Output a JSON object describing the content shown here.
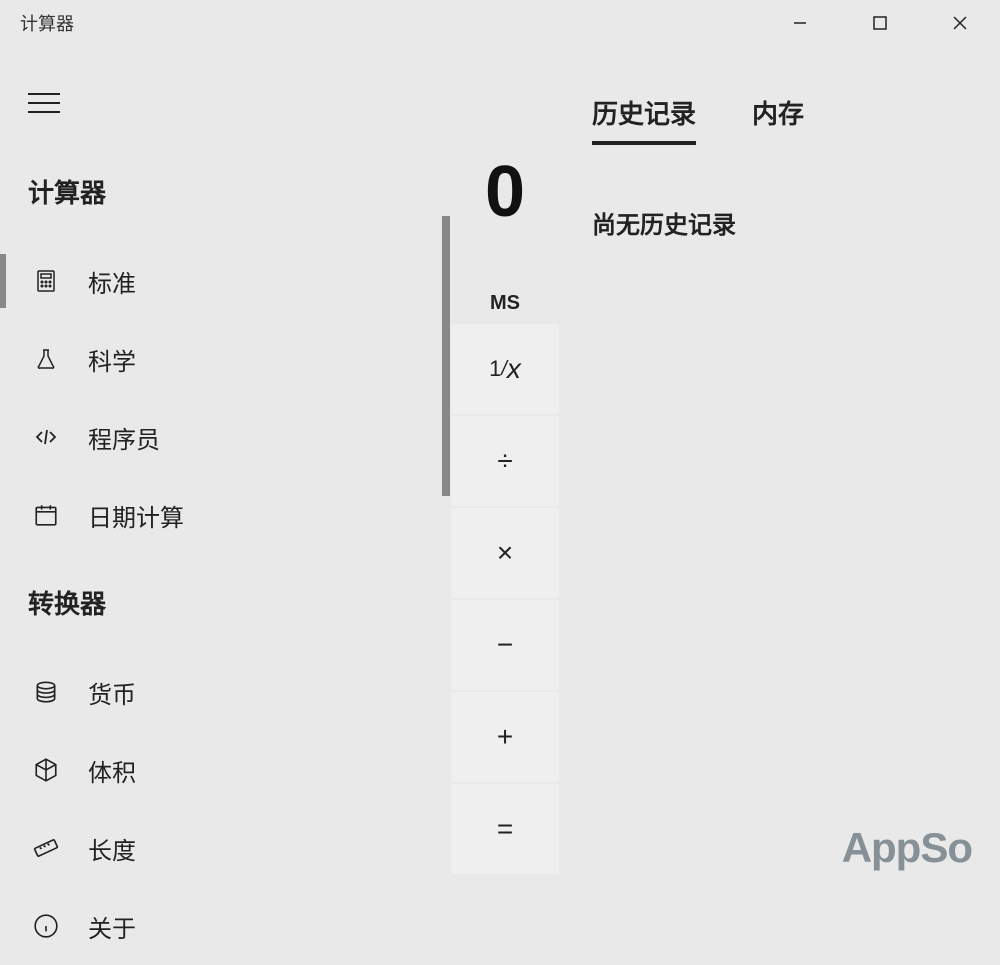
{
  "window": {
    "title": "计算器"
  },
  "sidebar": {
    "section_calculator": "计算器",
    "section_converter": "转换器",
    "items": {
      "standard": "标准",
      "scientific": "科学",
      "programmer": "程序员",
      "date": "日期计算",
      "currency": "货币",
      "volume": "体积",
      "length": "长度",
      "about": "关于"
    }
  },
  "display": {
    "value": "0",
    "ms_label": "MS",
    "reciprocal": "⅟ₓ",
    "divide": "÷",
    "multiply": "×",
    "subtract": "−",
    "add": "+",
    "equals": "="
  },
  "panel": {
    "tab_history": "历史记录",
    "tab_memory": "内存",
    "empty_history": "尚无历史记录"
  },
  "watermark": "AppSo"
}
